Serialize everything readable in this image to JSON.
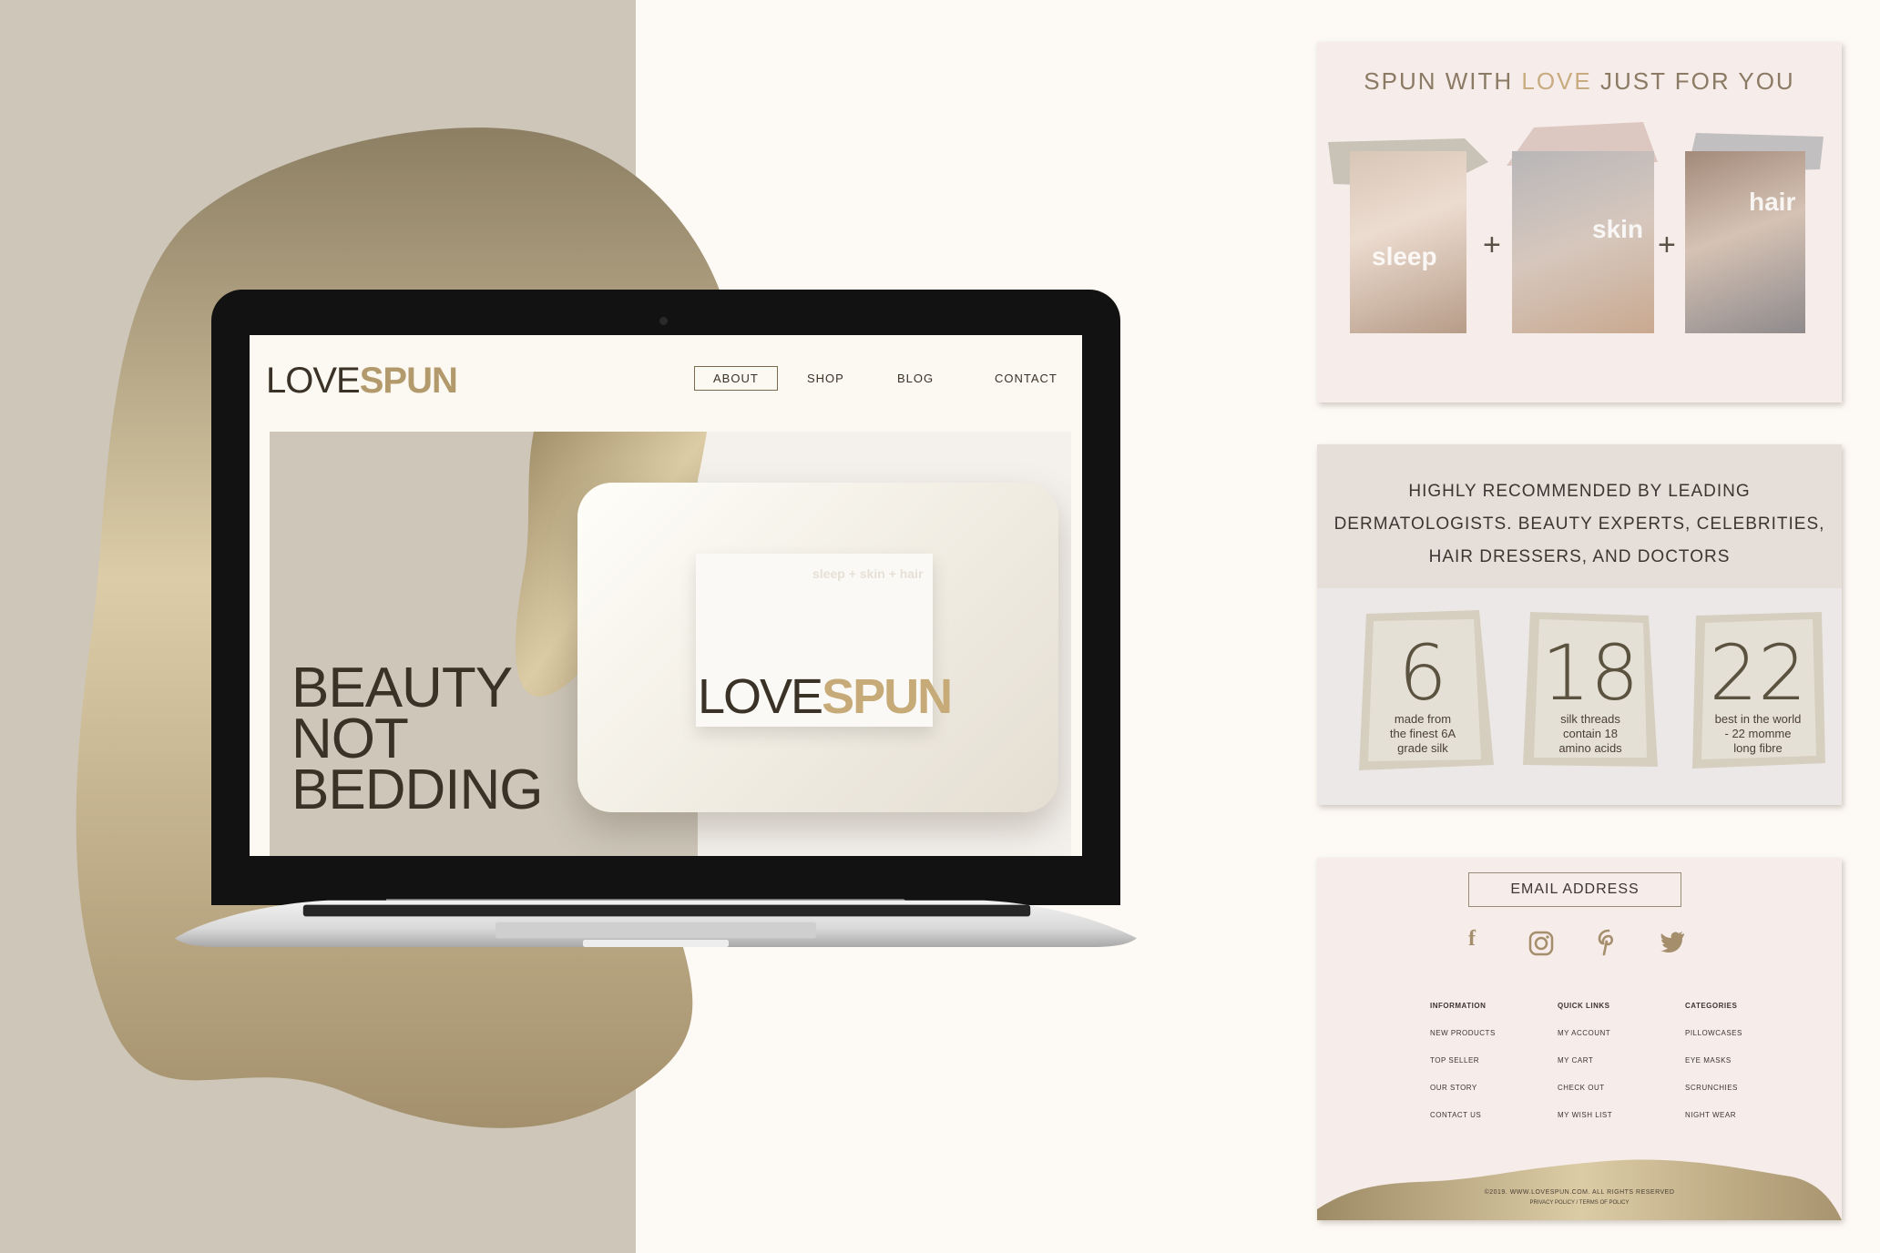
{
  "colors": {
    "gold": "#b39a6c",
    "taupe": "#cdc6b9",
    "ink": "#3a3226",
    "cream": "#fdf9f4"
  },
  "website": {
    "logo": {
      "light": "LOVE",
      "bold": "SPUN"
    },
    "nav": [
      "ABOUT",
      "SHOP",
      "BLOG",
      "CONTACT"
    ],
    "nav_active": "ABOUT",
    "hero": {
      "headline": [
        "BEAUTY",
        "NOT",
        "BEDDING"
      ],
      "card_tag": "sleep + skin + hair",
      "card_logo": {
        "light": "LOVE",
        "bold": "SPUN"
      }
    }
  },
  "panel_spun": {
    "title_a": "SPUN WITH ",
    "title_b": "LOVE",
    "title_c": " JUST FOR YOU",
    "tiles": [
      {
        "label": "sleep"
      },
      {
        "label": "skin"
      },
      {
        "label": "hair"
      }
    ],
    "plus": "+"
  },
  "panel_recommend": {
    "lines": [
      "HIGHLY RECOMMENDED BY LEADING",
      "DERMATOLOGISTS. BEAUTY EXPERTS, CELEBRITIES,",
      "HAIR DRESSERS, AND DOCTORS"
    ],
    "stats": [
      {
        "num": "6",
        "lines": [
          "made from",
          "the finest 6A",
          "grade silk"
        ]
      },
      {
        "num": "18",
        "lines": [
          "silk threads",
          "contain 18",
          "amino acids"
        ]
      },
      {
        "num": "22",
        "lines": [
          "best in the world",
          "- 22 momme",
          "long fibre"
        ]
      }
    ]
  },
  "panel_footer": {
    "email_label": "EMAIL ADDRESS",
    "social_icons": [
      "facebook-icon",
      "instagram-icon",
      "pinterest-icon",
      "twitter-icon"
    ],
    "columns": [
      {
        "head": "INFORMATION",
        "links": [
          "NEW PRODUCTS",
          "TOP SELLER",
          "OUR STORY",
          "CONTACT US"
        ]
      },
      {
        "head": "QUICK LINKS",
        "links": [
          "MY ACCOUNT",
          "MY CART",
          "CHECK OUT",
          "MY WISH LIST"
        ]
      },
      {
        "head": "CATEGORIES",
        "links": [
          "PILLOWCASES",
          "EYE MASKS",
          "SCRUNCHIES",
          "NIGHT WEAR"
        ]
      }
    ],
    "copyright": "©2019. WWW.LOVESPUN.COM. ALL RIGHTS RESERVED",
    "policy": "PRIVACY POLICY / TERMS OF POLICY"
  }
}
